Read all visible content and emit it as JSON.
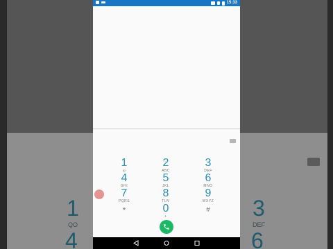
{
  "status_bar": {
    "time": "15:33"
  },
  "dialer": {
    "backspace_icon": "backspace-icon",
    "keys": [
      {
        "num": "1",
        "letters": "ω"
      },
      {
        "num": "2",
        "letters": "ABC"
      },
      {
        "num": "3",
        "letters": "DEF"
      },
      {
        "num": "4",
        "letters": "GHI"
      },
      {
        "num": "5",
        "letters": "JKL"
      },
      {
        "num": "6",
        "letters": "MNO"
      },
      {
        "num": "7",
        "letters": "PQRS"
      },
      {
        "num": "8",
        "letters": "TUV"
      },
      {
        "num": "9",
        "letters": "WXYZ"
      },
      {
        "num": "*",
        "letters": ""
      },
      {
        "num": "0",
        "letters": "+"
      },
      {
        "num": "#",
        "letters": ""
      }
    ],
    "call_icon": "phone-icon"
  },
  "background": {
    "digits": [
      "1",
      "3",
      "4",
      "6"
    ],
    "subs": [
      "QO",
      "DEF"
    ]
  },
  "colors": {
    "status_bar": "#1976c4",
    "digit": "#2a8fb0",
    "call": "#1db865"
  }
}
